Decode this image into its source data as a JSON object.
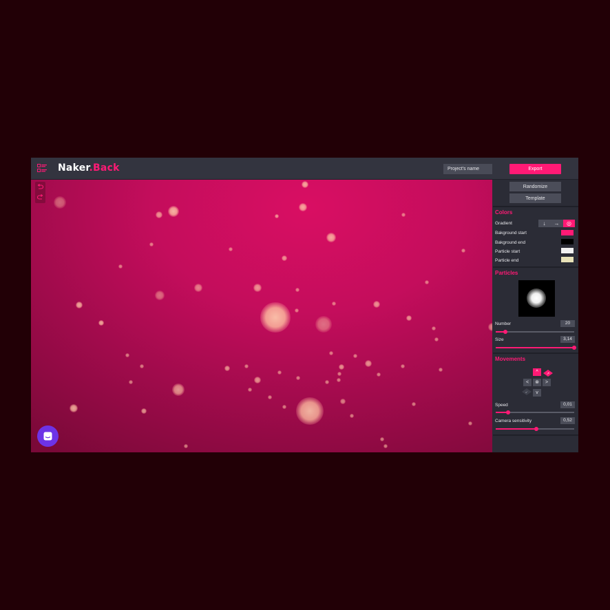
{
  "header": {
    "logo_main": "Naker",
    "logo_dot": ".",
    "logo_accent": "Back",
    "project_placeholder": "Project's name",
    "export_label": "Export"
  },
  "panel": {
    "randomize_label": "Randomize",
    "template_label": "Template",
    "colors": {
      "title": "Colors",
      "gradient_label": "Gradient",
      "gradient_options": [
        "↓",
        "→",
        "◎"
      ],
      "gradient_selected": "◎",
      "background_start_label": "Bakground start",
      "background_start_color": "#ff1a75",
      "background_end_label": "Bakground end",
      "background_end_color": "#000000",
      "particle_start_label": "Particle start",
      "particle_start_color": "#f2f2f2",
      "particle_end_label": "Particle end",
      "particle_end_color": "#e8e2b8"
    },
    "particles": {
      "title": "Particles",
      "number_label": "Number",
      "number_value": "20",
      "number_fraction": 0.12,
      "size_label": "Size",
      "size_value": "3,14",
      "size_fraction": 1.0
    },
    "movements": {
      "title": "Movements",
      "buttons": {
        "up": "^",
        "left": "<",
        "center": "⊗",
        "right": ">",
        "down": "v"
      },
      "selected": "up",
      "speed_label": "Speed",
      "speed_value": "0,01",
      "speed_fraction": 0.16,
      "camera_label": "Camera sensitivity",
      "camera_value": "0,52",
      "camera_fraction": 0.52
    }
  },
  "colors": {
    "accent": "#ff1a75",
    "panel_bg": "#2b2c36",
    "page_bg": "#220006",
    "chat_bg": "#6d33e6"
  }
}
